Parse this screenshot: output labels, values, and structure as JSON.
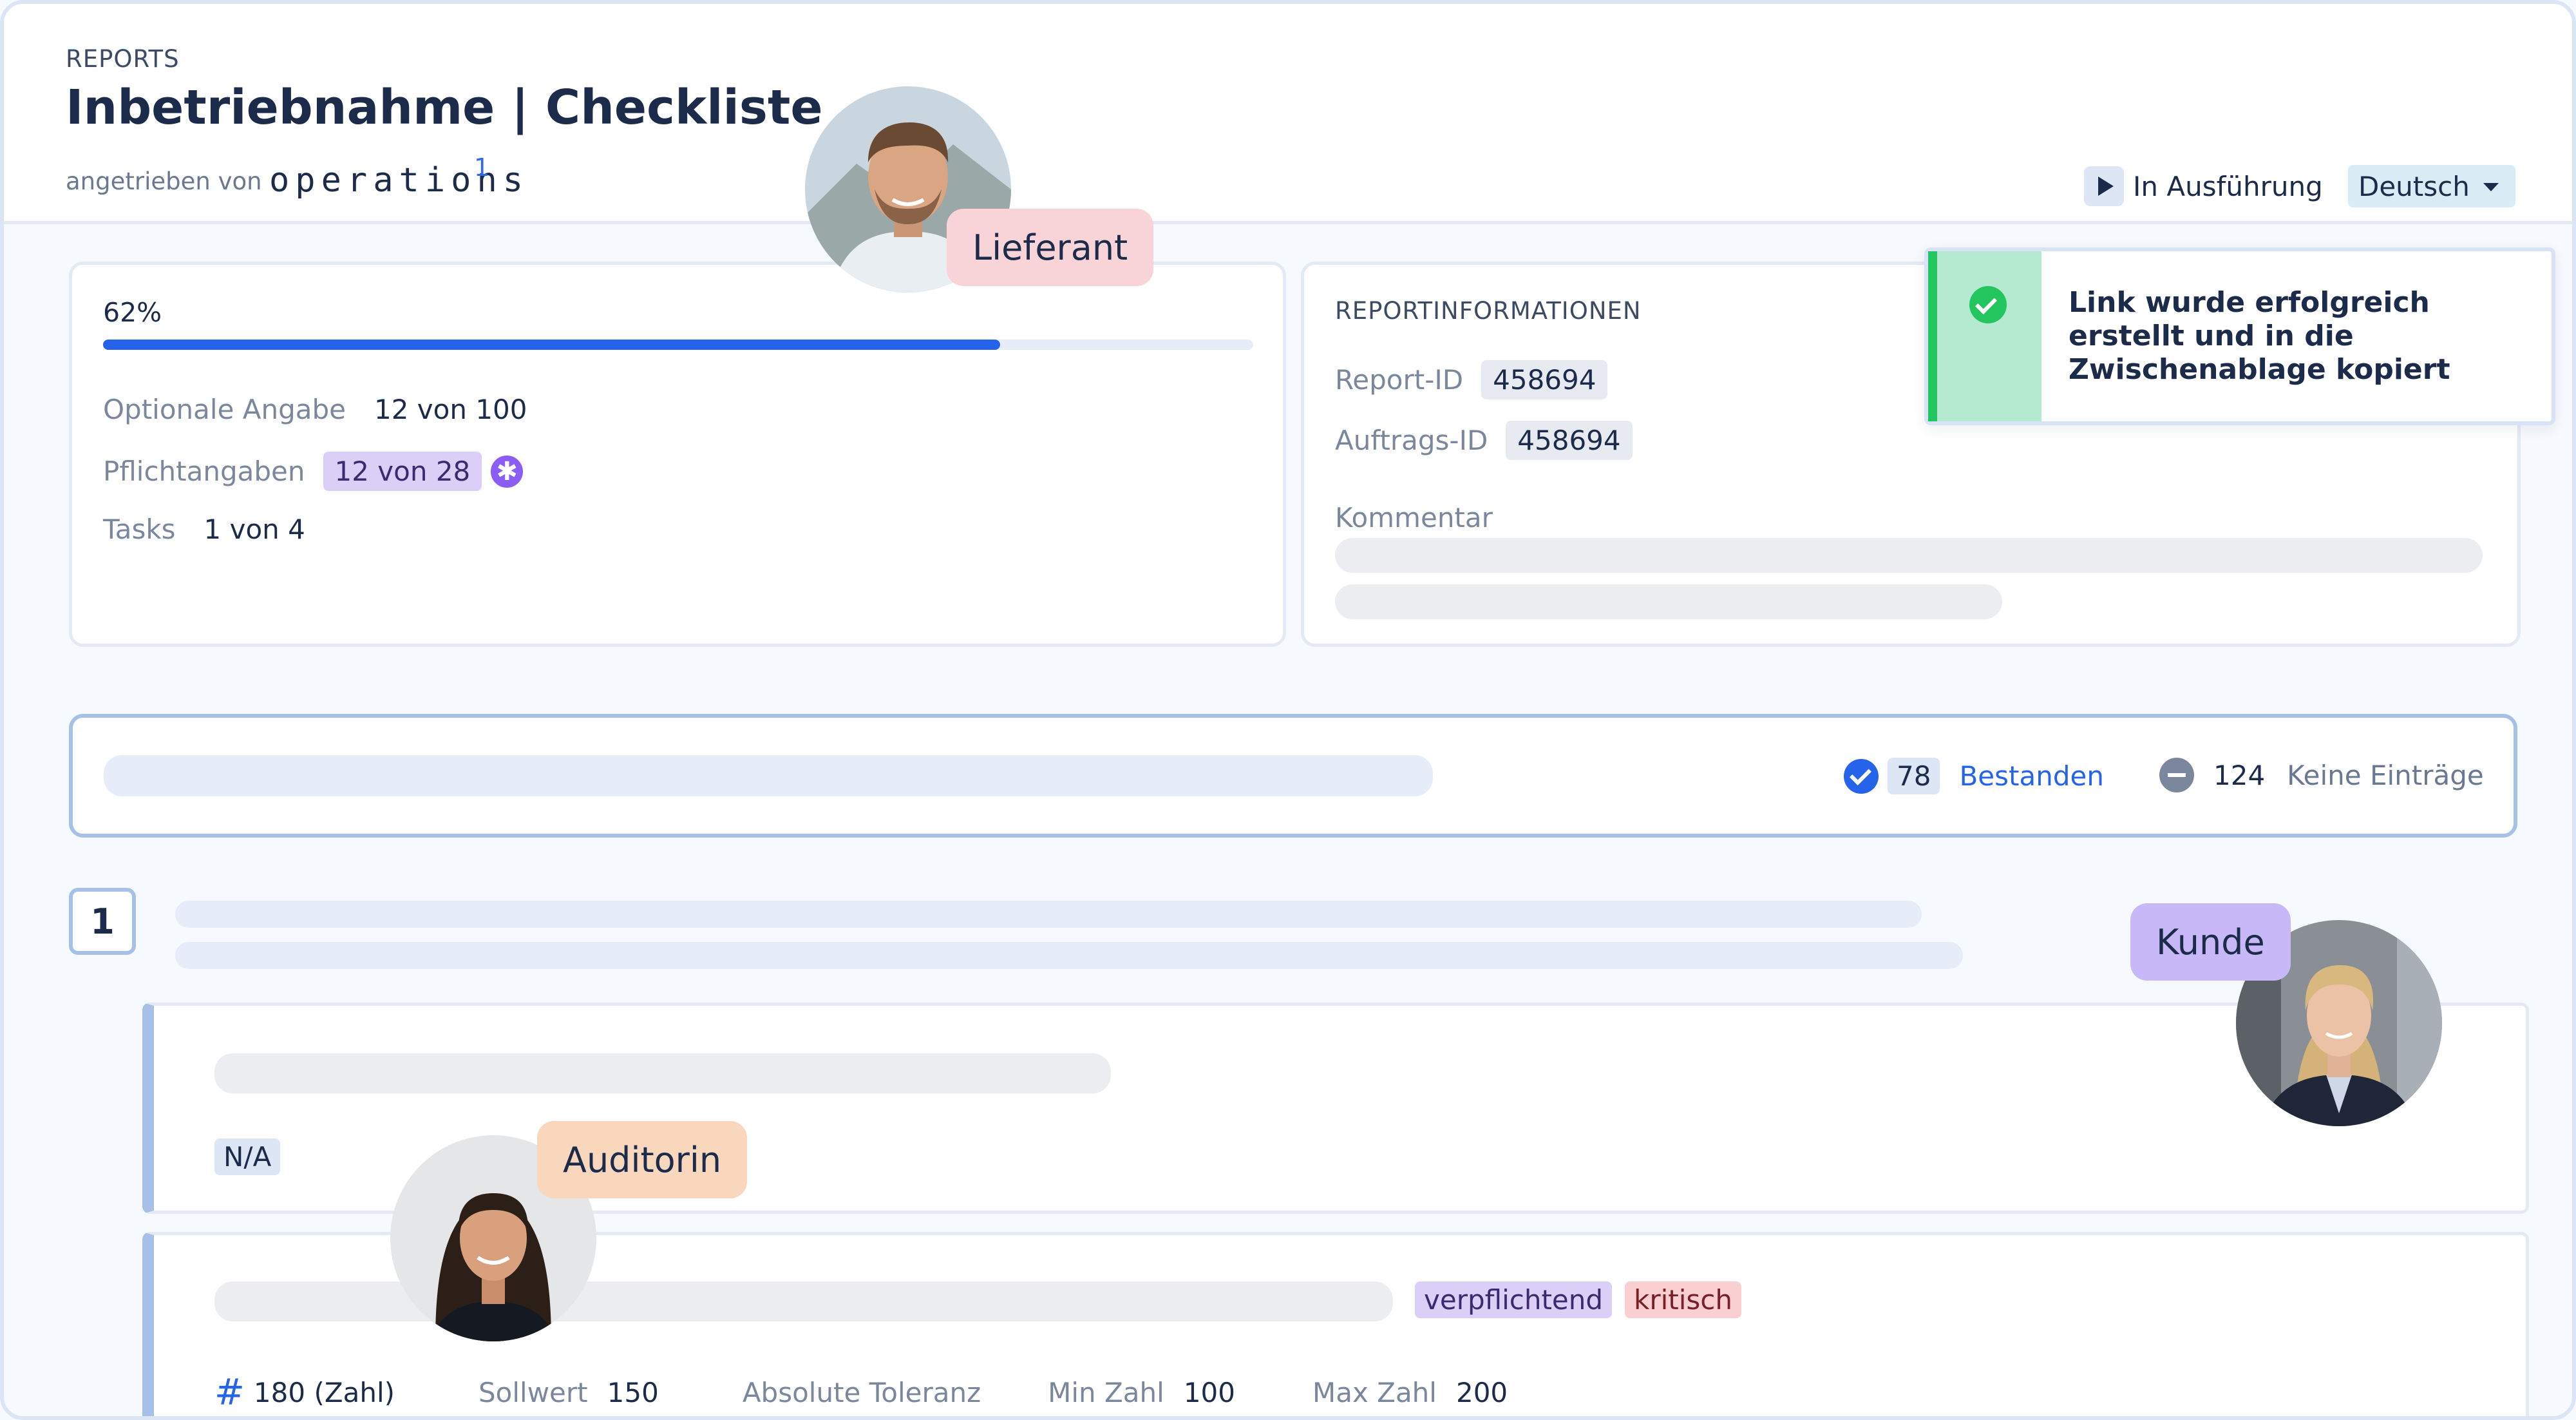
{
  "header": {
    "overline": "REPORTS",
    "title": "Inbetriebnahme | Checkliste",
    "powered_by": "angetrieben von",
    "brand": "operations",
    "brand_sup": "1",
    "status_label": "In Ausführung",
    "language": "Deutsch"
  },
  "progress": {
    "percent_label": "62%",
    "percent_value": 0.78,
    "rows": [
      {
        "label": "Optionale Angabe",
        "value": "12 von 100"
      },
      {
        "label": "Pflichtangaben",
        "value": "12 von 28"
      },
      {
        "label": "Tasks",
        "value": "1 von 4"
      }
    ]
  },
  "info": {
    "title": "REPORTINFORMATIONEN",
    "report_id_label": "Report-ID",
    "report_id": "458694",
    "order_id_label": "Auftrags-ID",
    "order_id": "458694",
    "comment_label": "Kommentar"
  },
  "toast": {
    "message": "Link wurde erfolgreich erstellt und in die Zwischenablage kopiert"
  },
  "summary": {
    "passed_count": "78",
    "passed_label": "Bestanden",
    "none_count": "124",
    "none_label": "Keine Einträge"
  },
  "section": {
    "number": "1"
  },
  "item1": {
    "na": "N/A"
  },
  "item2": {
    "tag_mandatory": "verpflichtend",
    "tag_critical": "kritisch",
    "value": "180 (Zahl)",
    "target_label": "Sollwert",
    "target": "150",
    "tolerance_label": "Absolute Toleranz",
    "min_label": "Min Zahl",
    "min": "100",
    "max_label": "Max Zahl",
    "max": "200"
  },
  "personas": {
    "supplier": "Lieferant",
    "customer": "Kunde",
    "auditor": "Auditorin"
  },
  "colors": {
    "accent": "#2563eb",
    "success": "#22c55e",
    "supplier_chip": "#f8d3d8",
    "customer_chip": "#c9b8f7",
    "auditor_chip": "#f8d7bd"
  }
}
